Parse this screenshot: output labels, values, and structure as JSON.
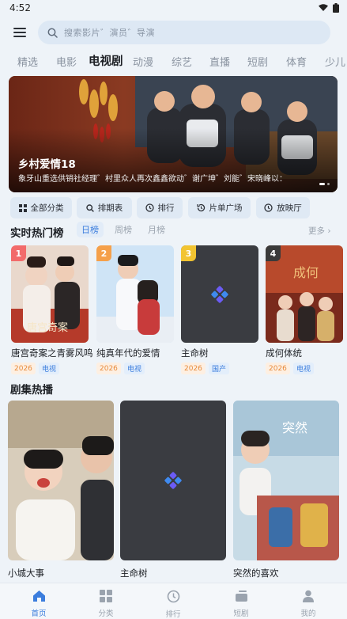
{
  "status": {
    "time": "4:52"
  },
  "search": {
    "placeholder": "搜索影片゛演员゛导演"
  },
  "tabs": [
    "精选",
    "电影",
    "电视剧",
    "动漫",
    "综艺",
    "直播",
    "短剧",
    "体育",
    "少儿"
  ],
  "active_tab": "电视剧",
  "banner": {
    "title": "乡村爱情18",
    "desc": "象牙山重选供销社经理゛村里众人再次鑫鑫欲动゛谢广坤゛刘能゛宋晓峰以："
  },
  "quick_buttons": [
    "全部分类",
    "排期表",
    "排行",
    "片单广场",
    "放映厅"
  ],
  "hot_rank": {
    "title": "实时热门榜",
    "ranges": [
      "日榜",
      "周榜",
      "月榜"
    ],
    "more": "更多",
    "items": [
      {
        "rank": "1",
        "name": "唐宫奇案之青雾风鸣",
        "year": "2026",
        "type": "电视"
      },
      {
        "rank": "2",
        "name": "纯真年代的爱情",
        "year": "2026",
        "type": "电视"
      },
      {
        "rank": "3",
        "name": "主命树",
        "year": "2026",
        "type": "国产"
      },
      {
        "rank": "4",
        "name": "成何体统",
        "year": "2026",
        "type": "电视"
      }
    ]
  },
  "hot_series": {
    "title": "剧集热播",
    "items": [
      {
        "name": "小城大事"
      },
      {
        "name": "主命树"
      },
      {
        "name": "突然的喜欢"
      }
    ]
  },
  "bottom_nav": [
    "首页",
    "分类",
    "排行",
    "短剧",
    "我的"
  ],
  "colors": {
    "accent": "#3b7ddd",
    "rank1": "#f26b6b",
    "rank2": "#f5a04a",
    "rank3": "#f2c431",
    "rank4": "#3a3a3a"
  }
}
